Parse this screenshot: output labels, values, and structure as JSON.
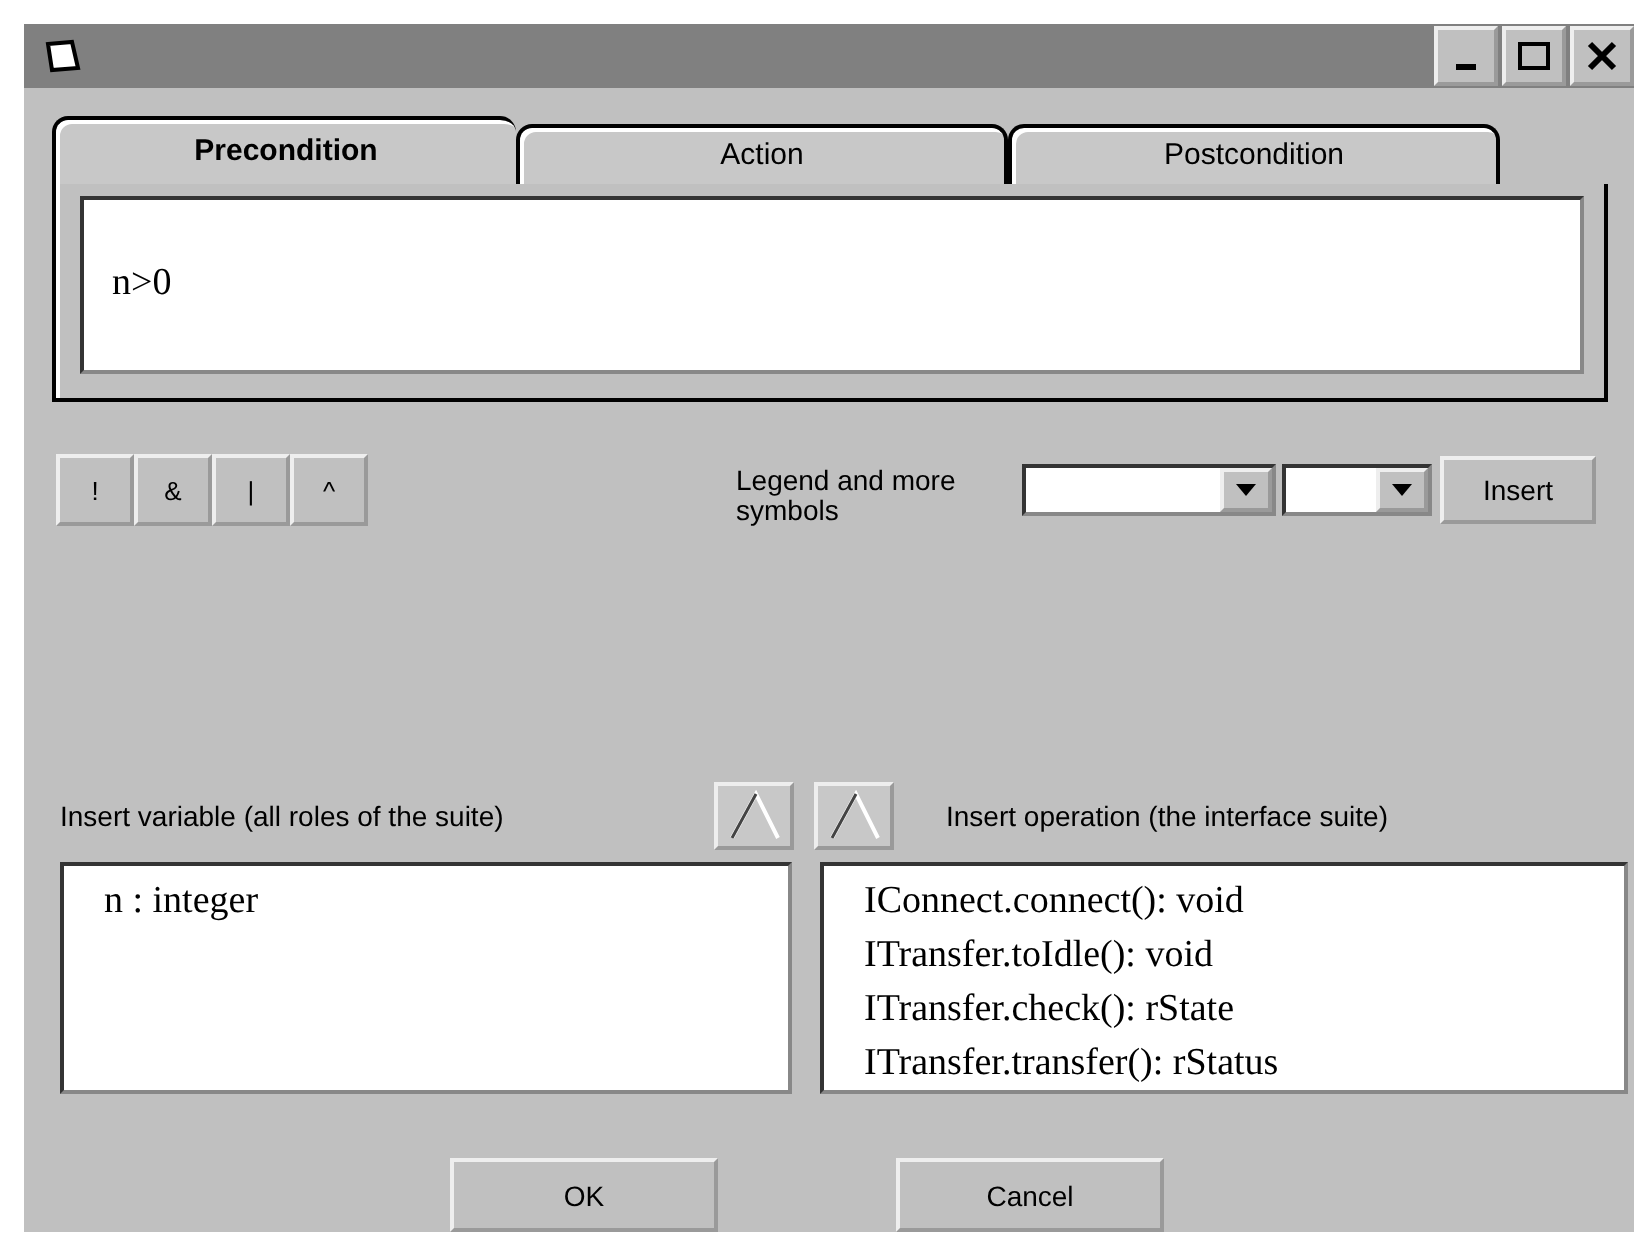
{
  "tabs": [
    {
      "label": "Precondition",
      "selected": true
    },
    {
      "label": "Action",
      "selected": false
    },
    {
      "label": "Postcondition",
      "selected": false
    }
  ],
  "expression": {
    "value": "n>0"
  },
  "symbol_buttons": [
    "!",
    "&",
    "|",
    "^"
  ],
  "legend": {
    "label": "Legend and more symbols",
    "button": "Insert"
  },
  "variables": {
    "label": "Insert variable (all roles of the suite)",
    "items": [
      "n : integer"
    ]
  },
  "operations": {
    "label": "Insert operation (the interface suite)",
    "items": [
      "IConnect.connect(): void",
      "ITransfer.toIdle(): void",
      "ITransfer.check(): rState",
      "ITransfer.transfer(): rStatus"
    ]
  },
  "buttons": [
    "OK",
    "Cancel"
  ]
}
